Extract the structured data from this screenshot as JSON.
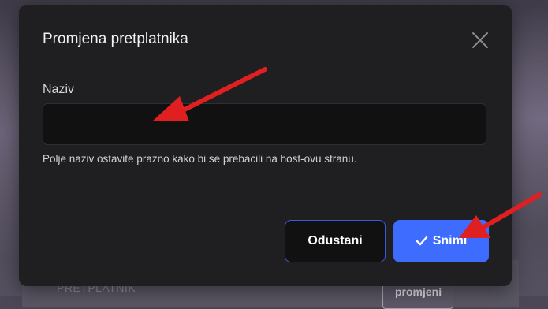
{
  "background": {
    "panel_label": "PRETPLATNIK",
    "button_label": "promjeni"
  },
  "modal": {
    "title": "Promjena pretplatnika",
    "close_icon": "close-icon",
    "field_label": "Naziv",
    "name_value": "",
    "name_placeholder": "",
    "helper_text": "Polje naziv ostavite prazno kako bi se prebacili na host-ovu stranu.",
    "cancel_label": "Odustani",
    "save_label": "Snimi",
    "save_icon": "check-icon"
  },
  "colors": {
    "modal_bg": "#1f1f21",
    "accent": "#3d6cff",
    "annotation": "#e02020"
  }
}
